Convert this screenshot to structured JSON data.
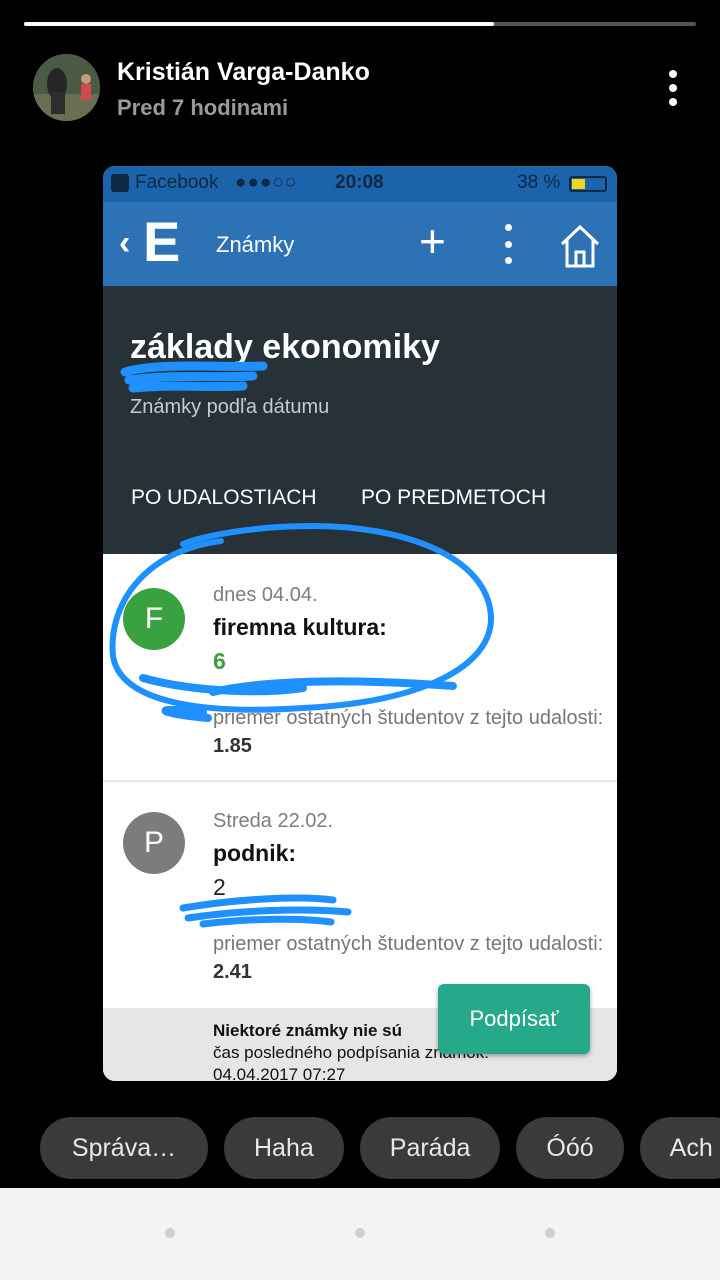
{
  "story": {
    "progress": 0.7
  },
  "header": {
    "author": "Kristián Varga-Danko",
    "time": "Pred 7 hodinami"
  },
  "screenshot": {
    "status_bar": {
      "app": "Facebook",
      "signal": "●●●○○",
      "time": "20:08",
      "battery": "38 %"
    },
    "toolbar": {
      "back": "‹",
      "logo": "E",
      "title": "Známky",
      "plus": "+"
    },
    "subject": {
      "title": "základy ekonomiky",
      "subtitle": "Známky podľa dátumu"
    },
    "tabs": [
      "PO UDALOSTIACH",
      "PO PREDMETOCH"
    ],
    "grades": [
      {
        "initial": "F",
        "date": "dnes 04.04.",
        "name": "firemna kultura:",
        "grade": "6",
        "avg_text": "priemer ostatných študentov z tejto udalosti:",
        "avg": "1.85"
      },
      {
        "initial": "P",
        "date": "Streda 22.02.",
        "name": "podnik:",
        "grade": "2",
        "avg_text": "priemer ostatných študentov z tejto udalosti:",
        "avg": "2.41"
      }
    ],
    "footer": {
      "bold": "Niektoré známky nie sú",
      "line2": "čas posledného podpísania známok:",
      "line3": "04.04.2017 07:27"
    },
    "sign_button": "Podpísať"
  },
  "reactions": [
    "Správa…",
    "Haha",
    "Paráda",
    "Óóó",
    "Ach"
  ],
  "colors": {
    "toolbar": "#2e72b6",
    "dark_header": "#263238",
    "grade_green": "#3aa141",
    "sign_button": "#26a88a",
    "scribble": "#1e90ff"
  }
}
